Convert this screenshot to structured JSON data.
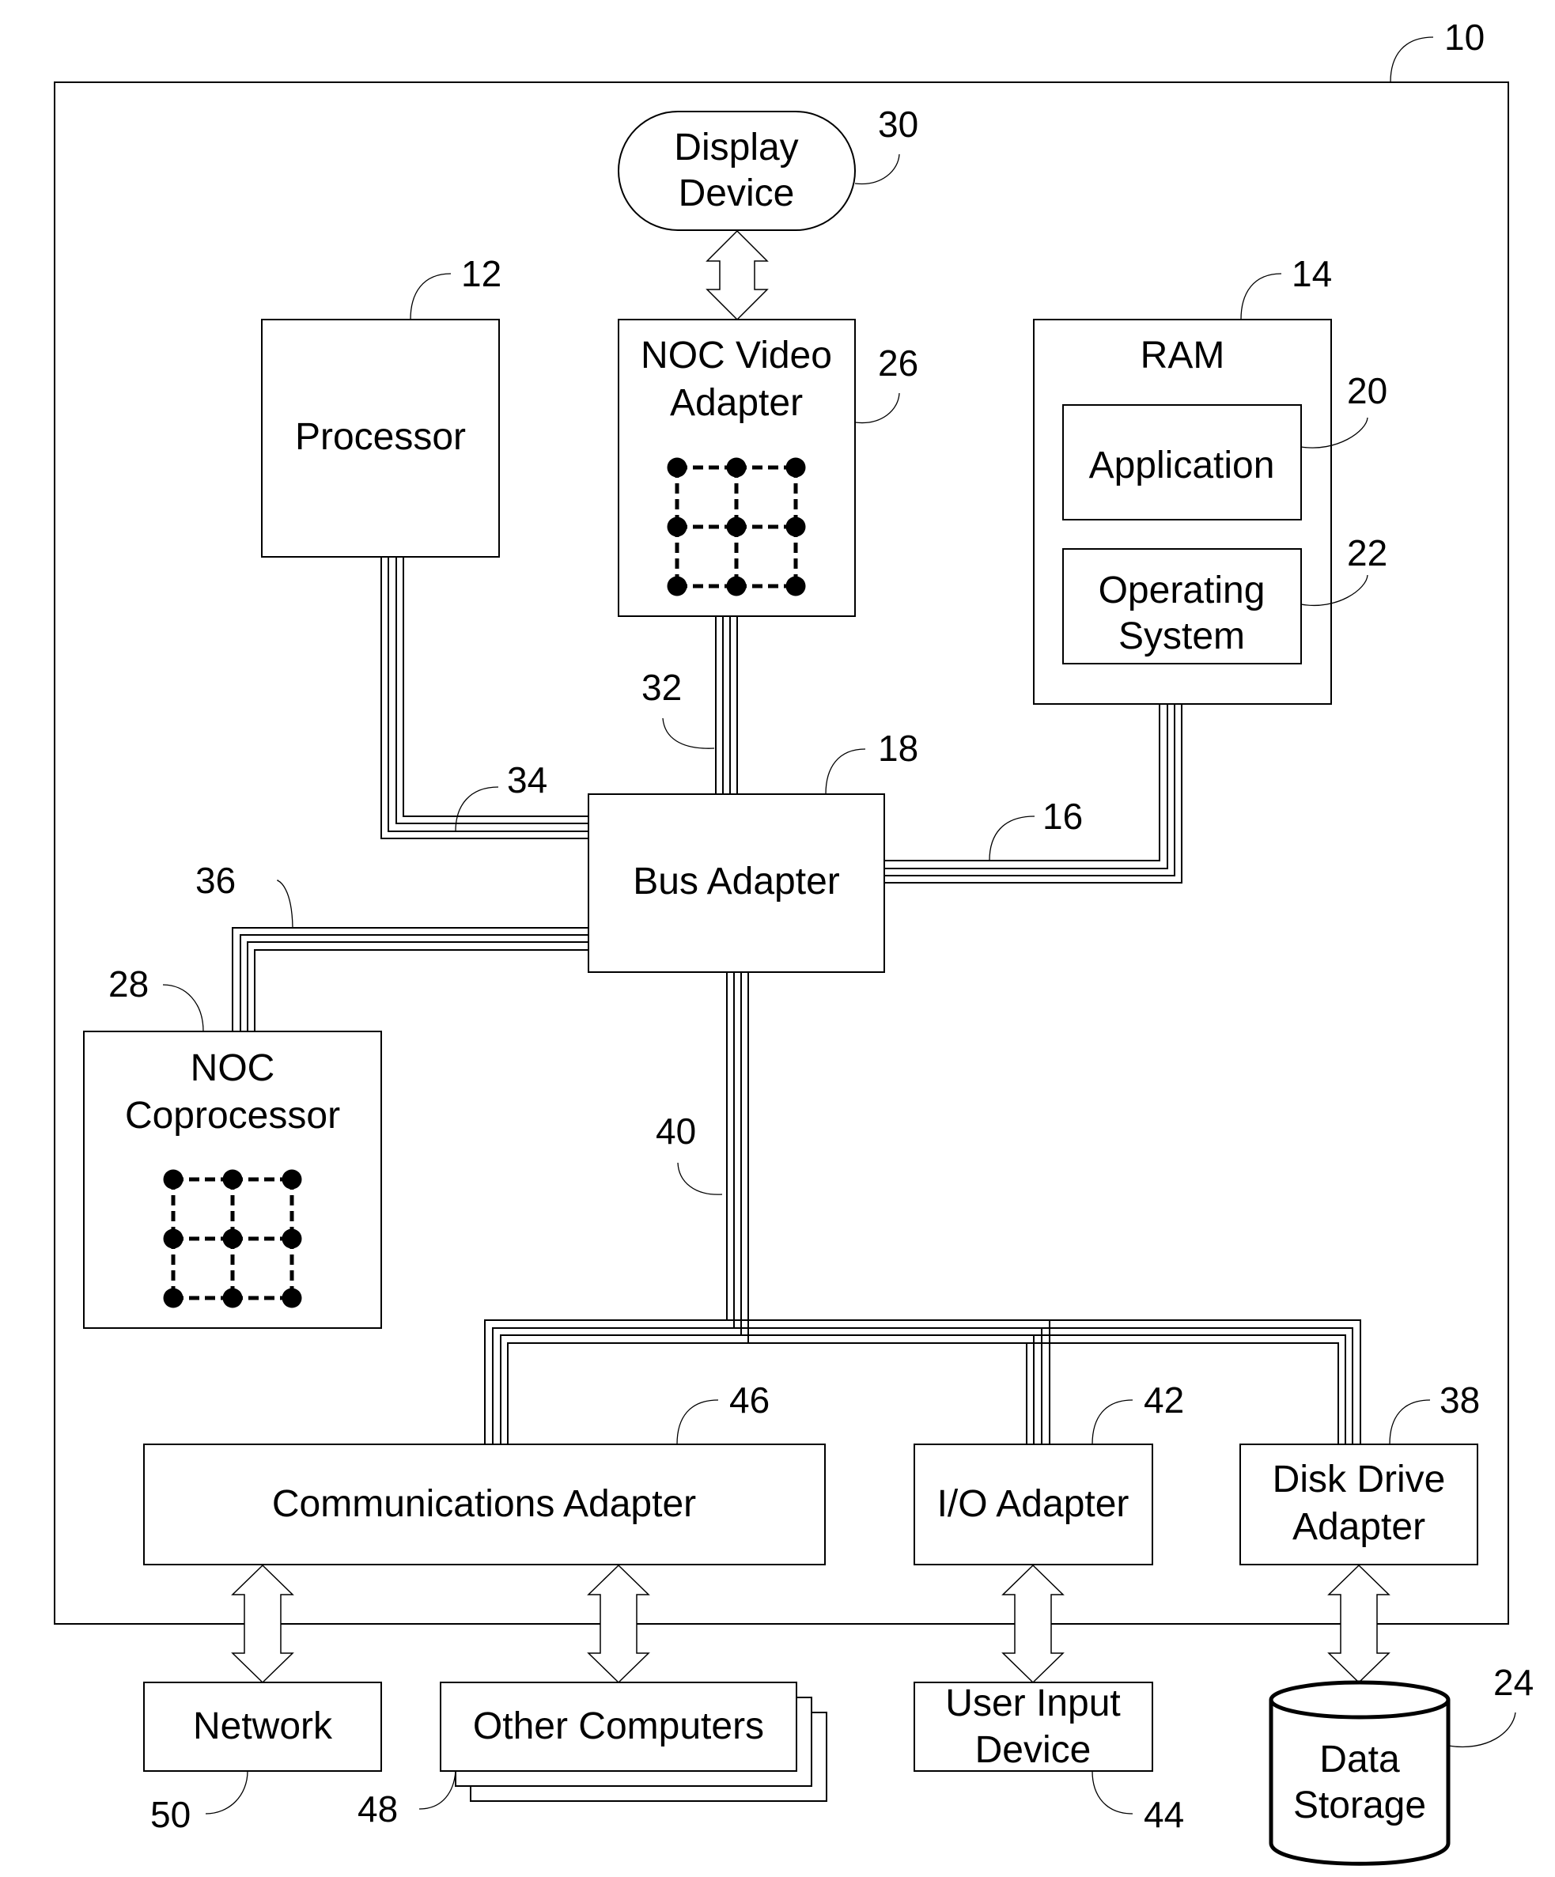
{
  "figure": {
    "system_ref": "10",
    "components": {
      "display_device": {
        "label_lines": [
          "Display",
          "Device"
        ],
        "ref": "30"
      },
      "processor": {
        "label": "Processor",
        "ref": "12"
      },
      "noc_video_adapter": {
        "label_lines": [
          "NOC Video",
          "Adapter"
        ],
        "ref": "26",
        "mesh": "3x3"
      },
      "ram": {
        "label": "RAM",
        "ref": "14"
      },
      "application": {
        "label": "Application",
        "ref": "20"
      },
      "operating_system": {
        "label_lines": [
          "Operating",
          "System"
        ],
        "ref": "22"
      },
      "bus_adapter": {
        "label": "Bus Adapter",
        "ref": "18"
      },
      "noc_coprocessor": {
        "label_lines": [
          "NOC",
          "Coprocessor"
        ],
        "ref": "28",
        "mesh": "3x3"
      },
      "communications_adapter": {
        "label": "Communications Adapter",
        "ref": "46"
      },
      "io_adapter": {
        "label": "I/O Adapter",
        "ref": "42"
      },
      "disk_drive_adapter": {
        "label_lines": [
          "Disk Drive",
          "Adapter"
        ],
        "ref": "38"
      },
      "network": {
        "label": "Network",
        "ref": "50"
      },
      "other_computers": {
        "label": "Other Computers",
        "ref": "48"
      },
      "user_input_device": {
        "label_lines": [
          "User Input",
          "Device"
        ],
        "ref": "44"
      },
      "data_storage": {
        "label_lines": [
          "Data",
          "Storage"
        ],
        "ref": "24"
      }
    },
    "buses": {
      "video_bus": "32",
      "front_side_bus": "34",
      "memory_bus": "16",
      "coprocessor_bus": "36",
      "expansion_bus": "40"
    }
  }
}
